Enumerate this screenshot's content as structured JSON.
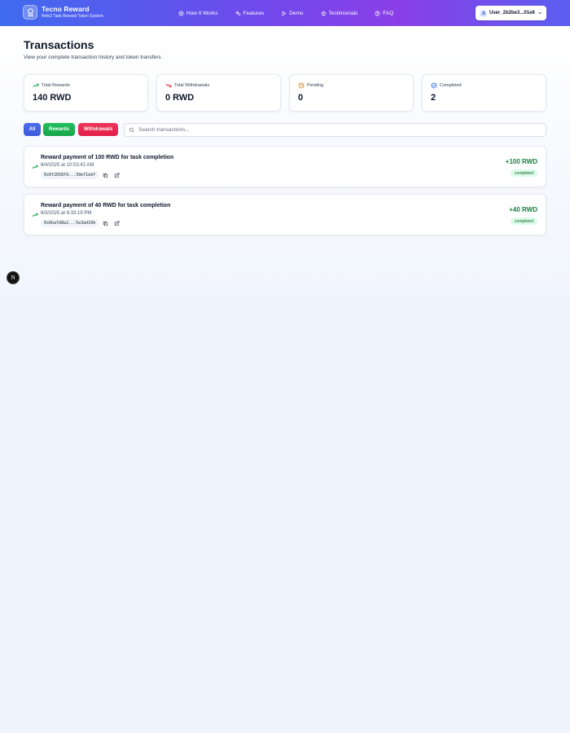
{
  "app": {
    "brand_title": "Tecno Reward",
    "brand_subtitle": "Web3 Task Reward Token System"
  },
  "nav": {
    "links": [
      {
        "label": "How It Works",
        "icon": "globe-icon"
      },
      {
        "label": "Features",
        "icon": "sparkles-icon"
      },
      {
        "label": "Demo",
        "icon": "play-icon"
      },
      {
        "label": "Testimonials",
        "icon": "star-icon"
      },
      {
        "label": "FAQ",
        "icon": "help-circle-icon"
      }
    ],
    "user_label": "User_2b2be3...01e8"
  },
  "header": {
    "title": "Transactions",
    "subtitle": "View your complete transaction history and token transfers"
  },
  "stats": [
    {
      "label": "Total Rewards",
      "value": "140 RWD",
      "icon": "trending-up-icon",
      "color": "#16a34a"
    },
    {
      "label": "Total Withdrawals",
      "value": "0 RWD",
      "icon": "trending-down-icon",
      "color": "#dc2626"
    },
    {
      "label": "Pending",
      "value": "0",
      "icon": "clock-icon",
      "color": "#d97706"
    },
    {
      "label": "Completed",
      "value": "2",
      "icon": "check-circle-icon",
      "color": "#2563eb"
    }
  ],
  "filters": {
    "all_label": "All",
    "rewards_label": "Rewards",
    "withdrawals_label": "Withdrawals",
    "search_placeholder": "Search transactions...",
    "colors": {
      "all": "#3b5bdb",
      "rewards": "#16a34a",
      "withdrawals": "#e11d48"
    }
  },
  "transactions": [
    {
      "description": "Reward payment of 100 RWD for task completion",
      "date": "8/4/2025 at 10:53:42 AM",
      "hash": "0x0f2658f9...39ef1ebf",
      "amount": "+100 RWD",
      "status": "completed"
    },
    {
      "description": "Reward payment of 40 RWD for task completion",
      "date": "8/3/2025 at 6:33:19 PM",
      "hash": "0x6ba7d8e2...5e3ad10b",
      "amount": "+40 RWD",
      "status": "completed"
    }
  ],
  "dev_badge": {
    "label": "N"
  }
}
